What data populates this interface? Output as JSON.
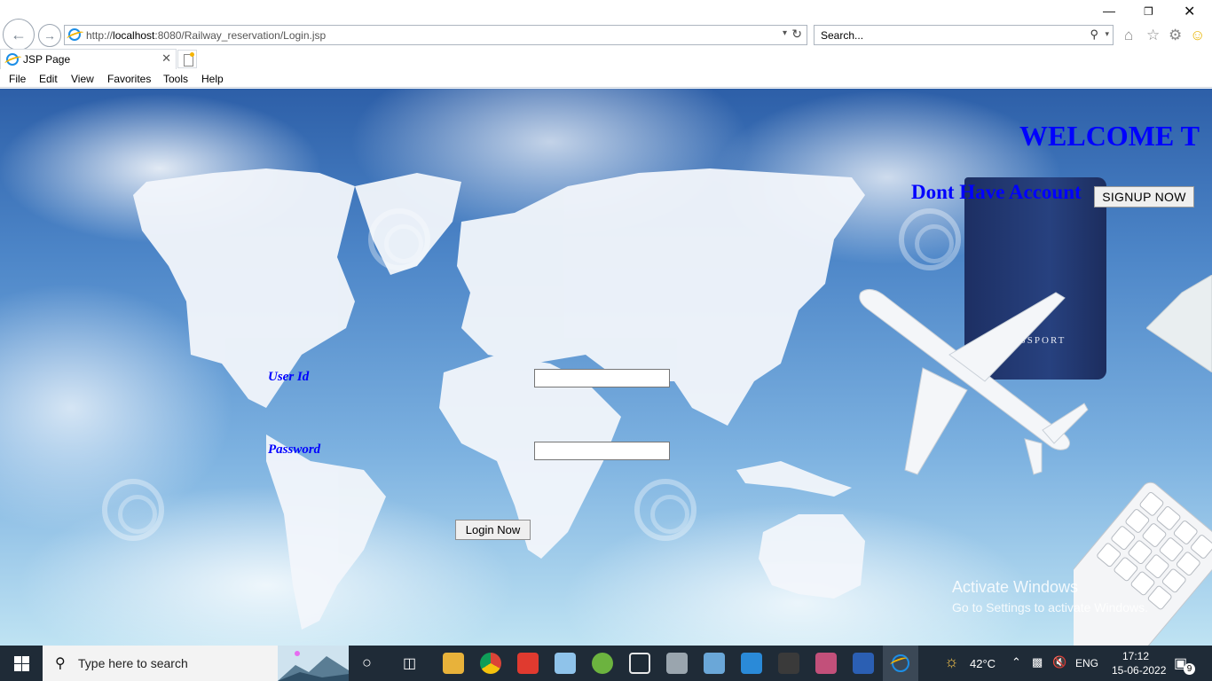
{
  "browser": {
    "url_prefix": "http://",
    "url_host": "localhost",
    "url_rest": ":8080/Railway_reservation/Login.jsp",
    "search_placeholder": "Search...",
    "tab_title": "JSP Page",
    "menu": [
      "File",
      "Edit",
      "View",
      "Favorites",
      "Tools",
      "Help"
    ]
  },
  "page": {
    "welcome": "WELCOME T",
    "no_account_text": "Dont Have Account",
    "signup_label": "SIGNUP  NOW",
    "userid_label": "User Id",
    "password_label": "Password",
    "login_label": "Login Now",
    "userid_value": "",
    "password_value": "",
    "passport_text": "PASSPORT",
    "text_color": "#0000ff"
  },
  "activation": {
    "title": "Activate Windows",
    "subtitle": "Go to Settings to activate Windows."
  },
  "taskbar": {
    "search_placeholder": "Type here to search",
    "weather": "42°C",
    "language": "ENG",
    "time": "17:12",
    "date": "15-06-2022",
    "notification_count": "9"
  }
}
